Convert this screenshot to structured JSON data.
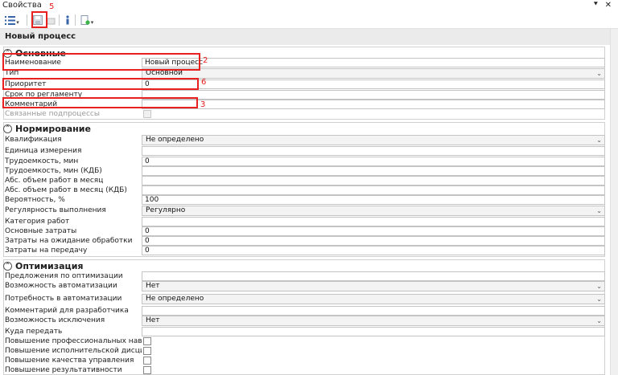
{
  "window": {
    "title": "Свойства",
    "pin_icon": "pin-icon",
    "close_icon": "close-icon"
  },
  "header": {
    "title": "Новый процесс"
  },
  "sections": {
    "basic": {
      "title": "Основные",
      "rows": {
        "name": {
          "label": "Наименование",
          "value": "Новый процесс"
        },
        "type": {
          "label": "Тип",
          "value": "Основной"
        },
        "priority": {
          "label": "Приоритет",
          "value": "0"
        },
        "deadline": {
          "label": "Срок по регламенту",
          "value": ""
        },
        "comment": {
          "label": "Комментарий",
          "value": ""
        },
        "linked": {
          "label": "Связанные подпроцессы"
        }
      }
    },
    "norm": {
      "title": "Нормирование",
      "rows": {
        "qualification": {
          "label": "Квалификация",
          "value": "Не определено"
        },
        "unit": {
          "label": "Единица измерения",
          "value": ""
        },
        "labor_min": {
          "label": "Трудоемкость, мин",
          "value": "0"
        },
        "labor_kdb": {
          "label": "Трудоемкость, мин (КДБ)",
          "value": ""
        },
        "abs_volume": {
          "label": "Абс. объем работ в месяц",
          "value": ""
        },
        "abs_volume_kdb": {
          "label": "Абс. объем работ в месяц (КДБ)",
          "value": ""
        },
        "probability": {
          "label": "Вероятность, %",
          "value": "100"
        },
        "regularity": {
          "label": "Регулярность выполнения",
          "value": "Регулярно"
        },
        "category": {
          "label": "Категория работ",
          "value": ""
        },
        "main_costs": {
          "label": "Основные затраты",
          "value": "0"
        },
        "wait_costs": {
          "label": "Затраты на ожидание обработки",
          "value": "0"
        },
        "transfer_costs": {
          "label": "Затраты на передачу",
          "value": "0"
        }
      }
    },
    "opt": {
      "title": "Оптимизация",
      "rows": {
        "proposals": {
          "label": "Предложения по оптимизации",
          "value": ""
        },
        "automation_possible": {
          "label": "Возможность автоматизации",
          "value": "Нет"
        },
        "automation_need": {
          "label": "Потребность в автоматизации",
          "value": "Не определено"
        },
        "dev_comment": {
          "label": "Комментарий для разработчика",
          "value": ""
        },
        "exclusion": {
          "label": "Возможность исключения",
          "value": "Нет"
        },
        "transfer_to": {
          "label": "Куда передать",
          "value": ""
        },
        "prof_skills": {
          "label": "Повышение профессиональных навыков"
        },
        "discipline": {
          "label": "Повышение исполнительской дисциплины"
        },
        "mgmt_quality": {
          "label": "Повышение качества управления"
        },
        "performance": {
          "label": "Повышение результативности"
        }
      }
    }
  },
  "annotations": {
    "n2": "2",
    "n3": "3",
    "n5": "5",
    "n6": "6",
    "color": "#e8201f"
  }
}
